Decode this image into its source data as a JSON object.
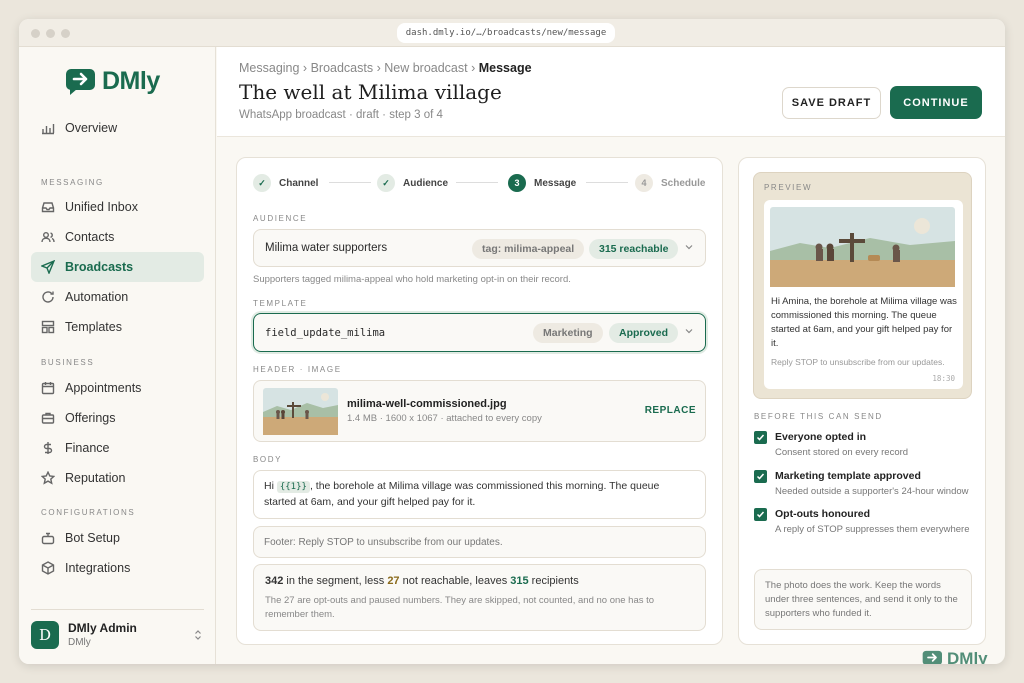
{
  "browser": {
    "url": "dash.dmly.io/…/broadcasts/new/message"
  },
  "brand": {
    "name": "DMly",
    "accent": "#1a6b4f"
  },
  "sidebar": {
    "overview": "Overview",
    "sections": {
      "messaging": "MESSAGING",
      "business": "BUSINESS",
      "configurations": "CONFIGURATIONS"
    },
    "items": {
      "unified_inbox": "Unified Inbox",
      "contacts": "Contacts",
      "broadcasts": "Broadcasts",
      "automation": "Automation",
      "templates": "Templates",
      "appointments": "Appointments",
      "offerings": "Offerings",
      "finance": "Finance",
      "reputation": "Reputation",
      "bot_setup": "Bot Setup",
      "integrations": "Integrations"
    },
    "user": {
      "initial": "D",
      "name": "DMly Admin",
      "org": "DMly"
    }
  },
  "header": {
    "breadcrumb": [
      "Messaging ›",
      "Broadcasts ›",
      "New broadcast ›",
      "Message"
    ],
    "title": "The well at Milima village",
    "subtitle": "WhatsApp broadcast · draft · step 3 of 4",
    "save_draft": "SAVE DRAFT",
    "continue": "CONTINUE"
  },
  "steps": [
    {
      "num": "✓",
      "label": "Channel"
    },
    {
      "num": "✓",
      "label": "Audience"
    },
    {
      "num": "3",
      "label": "Message"
    },
    {
      "num": "4",
      "label": "Schedule"
    }
  ],
  "form": {
    "audience_label": "AUDIENCE",
    "audience_name": "Milima water supporters",
    "audience_tag": "tag: milima-appeal",
    "audience_reach": "315 reachable",
    "audience_hint": "Supporters tagged milima-appeal who hold marketing opt-in on their record.",
    "template_label": "TEMPLATE",
    "template_name": "field_update_milima",
    "template_category": "Marketing",
    "template_status": "Approved",
    "header_label": "HEADER · IMAGE",
    "file_name": "milima-well-commissioned.jpg",
    "file_meta": "1.4 MB · 1600 x 1067 · attached to every copy",
    "replace": "REPLACE",
    "body_label": "BODY",
    "body_pre": "Hi",
    "body_var": "{{1}}",
    "body_rest": ", the borehole at Milima village was commissioned this morning. The queue started at 6am, and your gift helped pay for it.",
    "footer": "Footer: Reply STOP to unsubscribe from our updates.",
    "summary": {
      "segment": "342",
      "seg_text": " in the segment, less ",
      "unreach": "27",
      "unreach_text": " not reachable, leaves ",
      "recipients": "315",
      "rec_text": " recipients",
      "note": "The 27 are opt-outs and paused numbers. They are skipped, not counted, and no one has to remember them."
    }
  },
  "preview": {
    "label": "PREVIEW",
    "message": "Hi Amina, the borehole at Milima village was commissioned this morning. The queue started at 6am, and your gift helped pay for it.",
    "footer": "Reply STOP to unsubscribe from our updates.",
    "time": "18:30"
  },
  "checks": {
    "label": "BEFORE THIS CAN SEND",
    "items": [
      {
        "title": "Everyone opted in",
        "desc": "Consent stored on every record"
      },
      {
        "title": "Marketing template approved",
        "desc": "Needed outside a supporter's 24-hour window"
      },
      {
        "title": "Opt-outs honoured",
        "desc": "A reply of STOP suppresses them everywhere"
      }
    ]
  },
  "tip": "The photo does the work. Keep the words under three sentences, and send it only to the supporters who funded it."
}
